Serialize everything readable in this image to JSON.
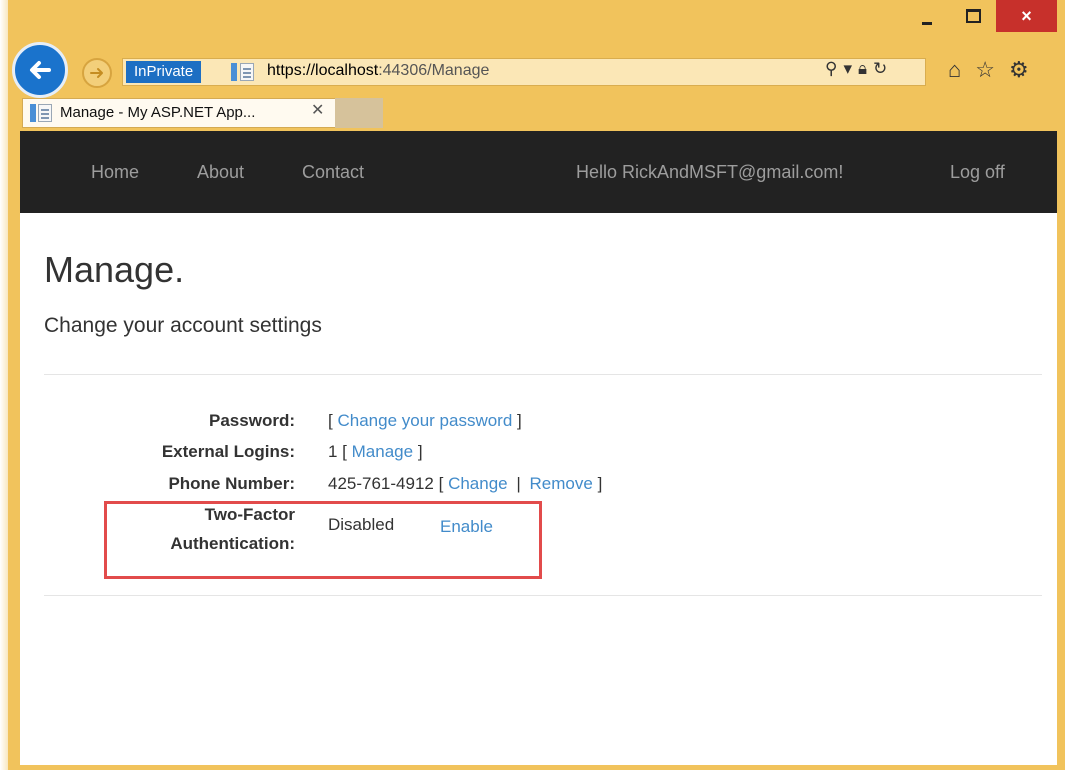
{
  "browser": {
    "inprivate_label": "InPrivate",
    "url_scheme": "https://",
    "url_host": "localhost",
    "url_port_path": ":44306/Manage",
    "tab_title": "Manage - My ASP.NET App...",
    "close_glyph": "×",
    "tab_close_glyph": "✕"
  },
  "navbar": {
    "home": "Home",
    "about": "About",
    "contact": "Contact",
    "greeting": "Hello RickAndMSFT@gmail.com!",
    "logoff": "Log off"
  },
  "page": {
    "title": "Manage.",
    "subtitle": "Change your account settings"
  },
  "settings": {
    "password_label": "Password:",
    "password_open": "[",
    "password_link": "Change your password",
    "password_close": "]",
    "external_label": "External Logins:",
    "external_count": "1 [",
    "external_link": "Manage",
    "external_close": "]",
    "phone_label": "Phone Number:",
    "phone_value": "425-761-4912 [",
    "phone_change": "Change",
    "phone_sep": "|",
    "phone_remove": "Remove",
    "phone_close": "]",
    "twofactor_label_1": "Two-Factor",
    "twofactor_label_2": "Authentication:",
    "twofactor_status": "Disabled",
    "twofactor_enable": "Enable"
  },
  "colors": {
    "frame": "#f1c35c",
    "navbar": "#222222",
    "link": "#428bca",
    "highlight": "#e24b4b"
  }
}
